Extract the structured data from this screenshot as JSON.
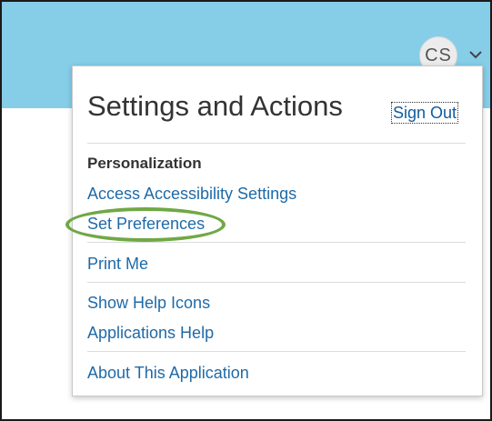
{
  "header": {
    "avatar_initials": "CS",
    "chevron_icon": "chevron-down-icon",
    "bar_color": "#86cde8"
  },
  "menu": {
    "title": "Settings and Actions",
    "sign_out_label": "Sign Out",
    "personalization_heading": "Personalization",
    "items": {
      "access_accessibility": "Access Accessibility Settings",
      "set_preferences": "Set Preferences",
      "print_me": "Print Me",
      "show_help_icons": "Show Help Icons",
      "applications_help": "Applications Help",
      "about_application": "About This Application"
    },
    "link_color": "#1f6aa8",
    "highlight_color": "#70a845"
  }
}
